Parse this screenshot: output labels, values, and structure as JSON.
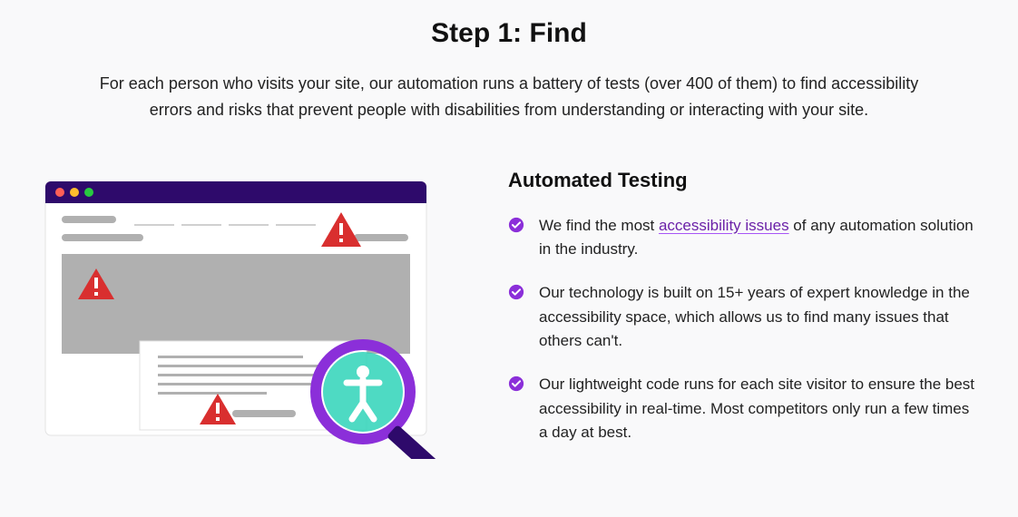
{
  "heading": "Step 1: Find",
  "intro": "For each person who visits your site, our automation runs a battery of tests (over 400 of them) to find accessibility errors and risks that prevent people with disabilities from understanding or interacting with your site.",
  "subheading": "Automated Testing",
  "bullets": [
    {
      "before": "We find the most ",
      "link": "accessibility issues",
      "after": " of any automation solution in the industry."
    },
    {
      "text": "Our technology is built on 15+ years of expert knowledge in the accessibility space, which allows us to find many issues that others can't."
    },
    {
      "text": "Our lightweight code runs for each site visitor to ensure the best accessibility in real-time. Most competitors only run a few times a day at best."
    }
  ],
  "colors": {
    "accent_purple": "#8b2fd9",
    "deep_purple": "#2e0a6b",
    "teal": "#2fd4b8",
    "red": "#d92f2f",
    "gray": "#b0b0b0"
  }
}
